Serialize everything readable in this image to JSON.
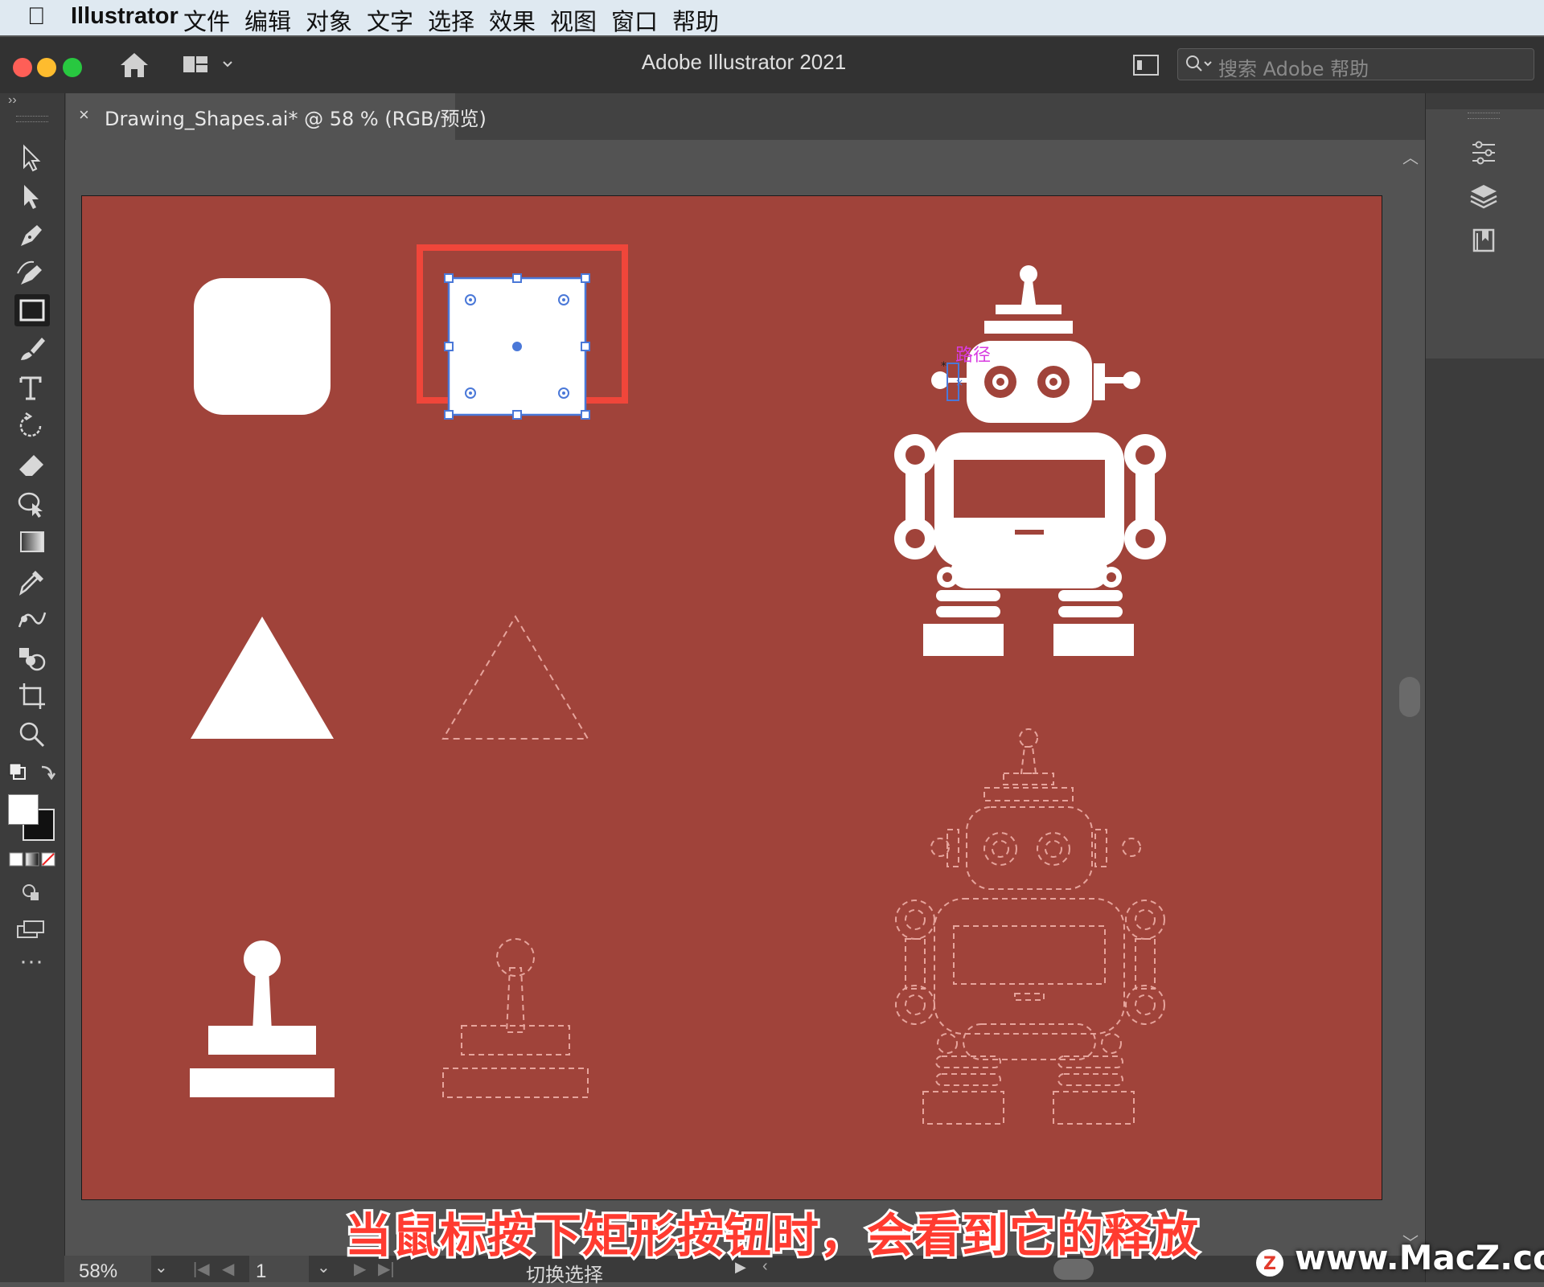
{
  "menubar": {
    "app_name": "Illustrator",
    "items": [
      "文件",
      "编辑",
      "对象",
      "文字",
      "选择",
      "效果",
      "视图",
      "窗口",
      "帮助"
    ]
  },
  "titlebar": {
    "title": "Adobe Illustrator 2021",
    "search_placeholder": "搜索 Adobe 帮助"
  },
  "tab": {
    "close_glyph": "×",
    "label": "Drawing_Shapes.ai* @ 58 % (RGB/预览)"
  },
  "canvas": {
    "artboard_color": "#a0433a",
    "selection_color": "#4a78d8",
    "highlight_color": "#f0463a",
    "path_tooltip": "路径"
  },
  "status": {
    "zoom": "58%",
    "page": "1",
    "mode": "切换选择"
  },
  "caption": "当鼠标按下矩形按钮时，会看到它的释放",
  "watermark": "www.MacZ.com",
  "tools": [
    "selection-tool-icon",
    "direct-selection-tool-icon",
    "pen-tool-icon",
    "curvature-tool-icon",
    "rectangle-tool-icon",
    "paintbrush-tool-icon",
    "type-tool-icon",
    "rotate-tool-icon",
    "eraser-tool-icon",
    "shape-builder-tool-icon",
    "gradient-tool-icon",
    "eyedropper-tool-icon",
    "blend-tool-icon",
    "symbol-sprayer-tool-icon",
    "artboard-tool-icon",
    "zoom-tool-icon"
  ]
}
